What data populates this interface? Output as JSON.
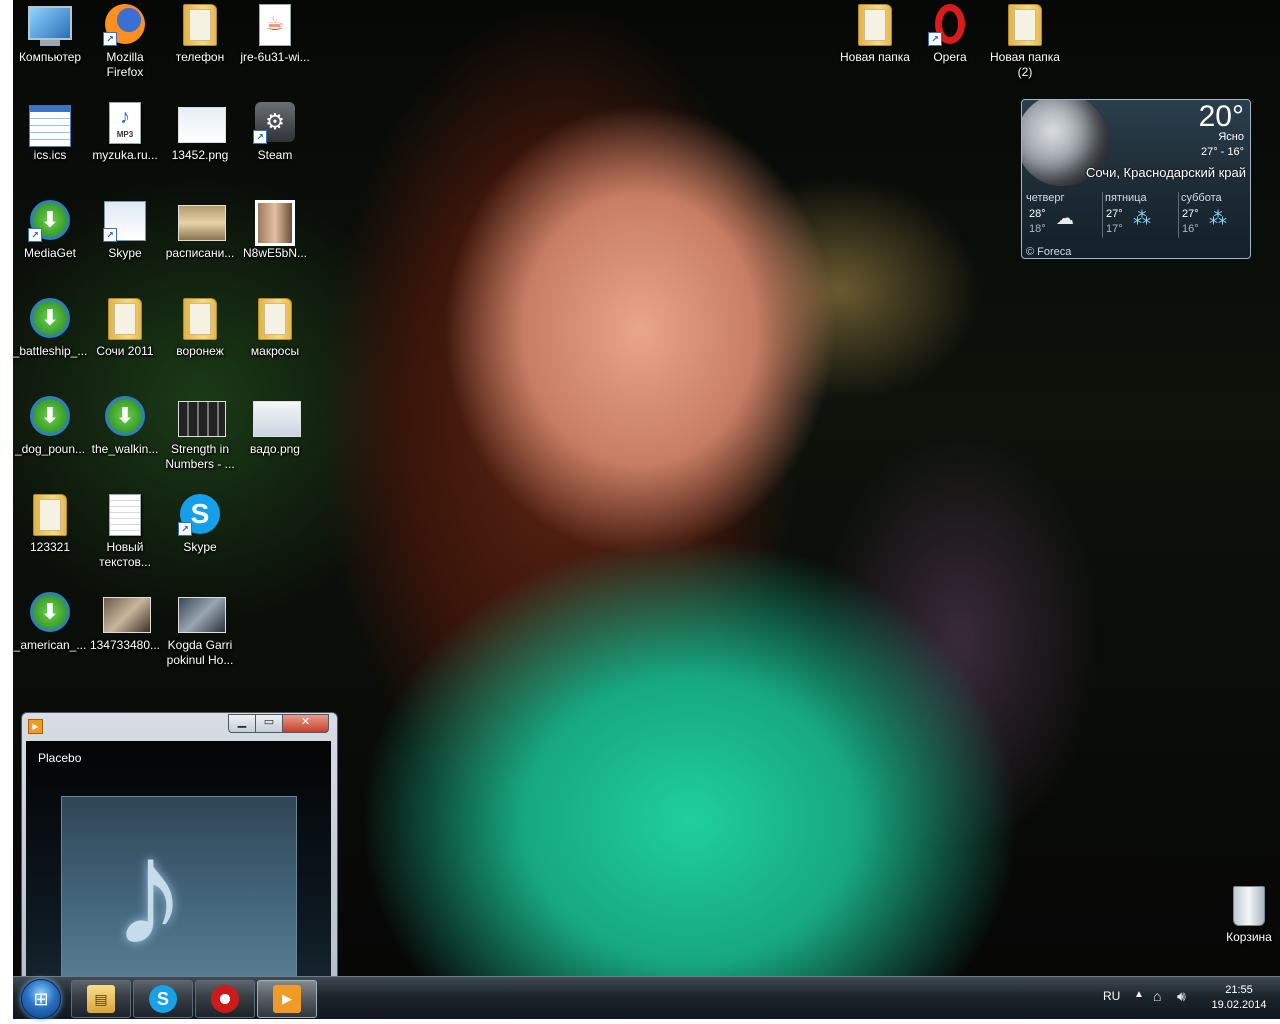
{
  "desktop": {
    "icons": [
      {
        "label": "Компьютер",
        "icon": "computer-icon"
      },
      {
        "label": "Mozilla\nFirefox",
        "icon": "firefox-icon"
      },
      {
        "label": "телефон",
        "icon": "folder-icon"
      },
      {
        "label": "jre-6u31-wi...",
        "icon": "java-icon"
      },
      {
        "label": "ics.ics",
        "icon": "calendar-icon"
      },
      {
        "label": "myzuka.ru...",
        "icon": "mp3-icon"
      },
      {
        "label": "13452.png",
        "icon": "image-icon"
      },
      {
        "label": "Steam",
        "icon": "steam-icon"
      },
      {
        "label": "MediaGet",
        "icon": "mediaget-icon"
      },
      {
        "label": "Skype",
        "icon": "skype-window-icon"
      },
      {
        "label": "расписани...",
        "icon": "image-icon"
      },
      {
        "label": "N8wE5bN...",
        "icon": "photo-icon"
      },
      {
        "label": "_battleship_...",
        "icon": "mediaget-icon"
      },
      {
        "label": "Сочи 2011",
        "icon": "folder-icon"
      },
      {
        "label": "воронеж",
        "icon": "folder-icon"
      },
      {
        "label": "макросы",
        "icon": "folder-icon"
      },
      {
        "label": "_dog_poun...",
        "icon": "mediaget-icon"
      },
      {
        "label": "the_walkin...",
        "icon": "mediaget-icon"
      },
      {
        "label": "Strength in\nNumbers - ...",
        "icon": "video-icon"
      },
      {
        "label": "вадо.png",
        "icon": "image-icon"
      },
      {
        "label": "123321",
        "icon": "folder-icon"
      },
      {
        "label": "Новый\nтекстов...",
        "icon": "text-document-icon"
      },
      {
        "label": "Skype",
        "icon": "skype-icon"
      },
      {
        "label": "_american_...",
        "icon": "mediaget-icon"
      },
      {
        "label": "134733480...",
        "icon": "photo-icon"
      },
      {
        "label": "Kogda Garri\npokinul Ho...",
        "icon": "video-icon"
      },
      {
        "label": "Новая папка",
        "icon": "folder-icon"
      },
      {
        "label": "Opera",
        "icon": "opera-icon"
      },
      {
        "label": "Новая папка\n(2)",
        "icon": "folder-icon"
      },
      {
        "label": "Корзина",
        "icon": "recycle-bin-icon"
      }
    ]
  },
  "weather": {
    "temp": "20°",
    "condition": "Ясно",
    "range": "27°  -  16°",
    "city": "Сочи, Краснодарский край",
    "forecast": [
      {
        "day": "четверг",
        "hi": "28°",
        "lo": "18°",
        "icon": "cloudy-icon"
      },
      {
        "day": "пятница",
        "hi": "27°",
        "lo": "17°",
        "icon": "rain-icon"
      },
      {
        "day": "суббота",
        "hi": "27°",
        "lo": "16°",
        "icon": "rain-icon"
      }
    ],
    "credit": "© Foreca"
  },
  "player": {
    "track": "Placebo",
    "min_label": "▁",
    "max_label": "▭",
    "close_label": "✕"
  },
  "taskbar": {
    "buttons": [
      "explorer-icon",
      "skype-icon",
      "opera-icon",
      "media-player-icon"
    ],
    "tray": {
      "lang": "RU",
      "time": "21:55",
      "date": "19.02.2014"
    }
  }
}
